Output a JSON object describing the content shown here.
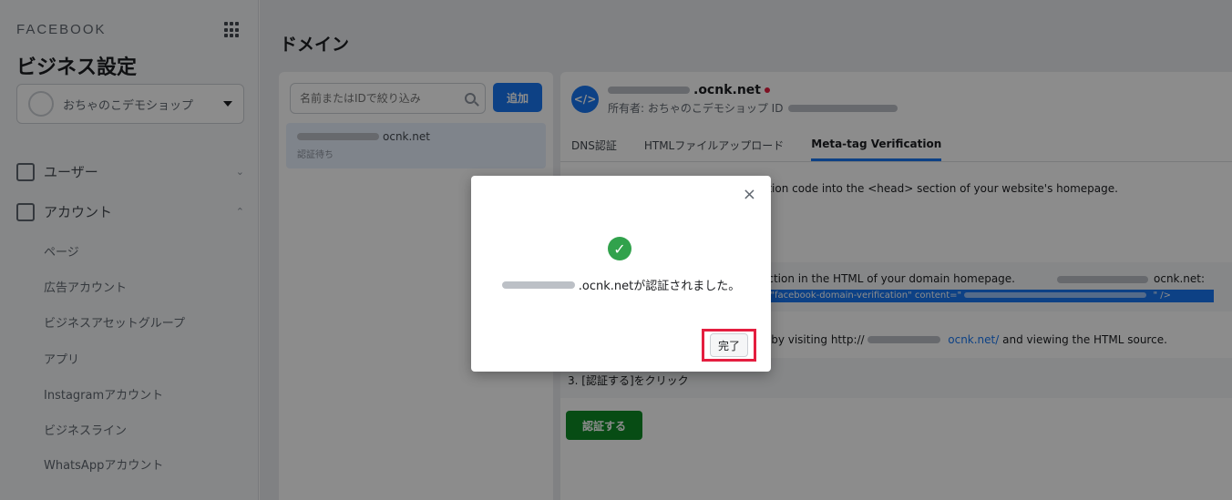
{
  "sidebar": {
    "brand": "FACEBOOK",
    "title": "ビジネス設定",
    "business_name": "おちゃのこデモショップ",
    "nav": [
      {
        "label": "ユーザー",
        "chevron": "⌄"
      },
      {
        "label": "アカウント",
        "chevron": "⌃"
      }
    ],
    "sub_items": [
      "ページ",
      "広告アカウント",
      "ビジネスアセットグループ",
      "アプリ",
      "Instagramアカウント",
      "ビジネスライン",
      "WhatsAppアカウント"
    ]
  },
  "main": {
    "title": "ドメイン",
    "search_placeholder": "名前またはIDで絞り込み",
    "add_label": "追加",
    "domain_item": {
      "name": "ocnk.net",
      "status": "認証待ち"
    },
    "detail": {
      "icon_label": "</>",
      "domain": ".ocnk.net",
      "owner": "所有者: おちゃのこデモショップ ID",
      "tabs": [
        "DNS認証",
        "HTMLファイルアップロード",
        "Meta-tag Verification"
      ],
      "step1": "ation code into the <head> section of your website's homepage.",
      "step2_line1": "ection in the HTML of your domain homepage.",
      "step2_domain": "ocnk.net:",
      "step2_code": "=\"facebook-domain-verification\" content=\"",
      "step2_code_end": "\" />",
      "step2b_pre": "e by visiting http://",
      "step2b_domain": "ocnk.net/",
      "step2b_post": "and viewing the HTML source.",
      "step3": "3. [認証する]をクリック",
      "verify_label": "認証する"
    }
  },
  "modal": {
    "close": "×",
    "check": "✓",
    "message": ".ocnk.netが認証されました。",
    "done_label": "完了"
  },
  "colors": {
    "accent": "#1877f2",
    "success": "#31a24c",
    "verify": "#0d8a26",
    "highlight": "#e41e3f"
  }
}
